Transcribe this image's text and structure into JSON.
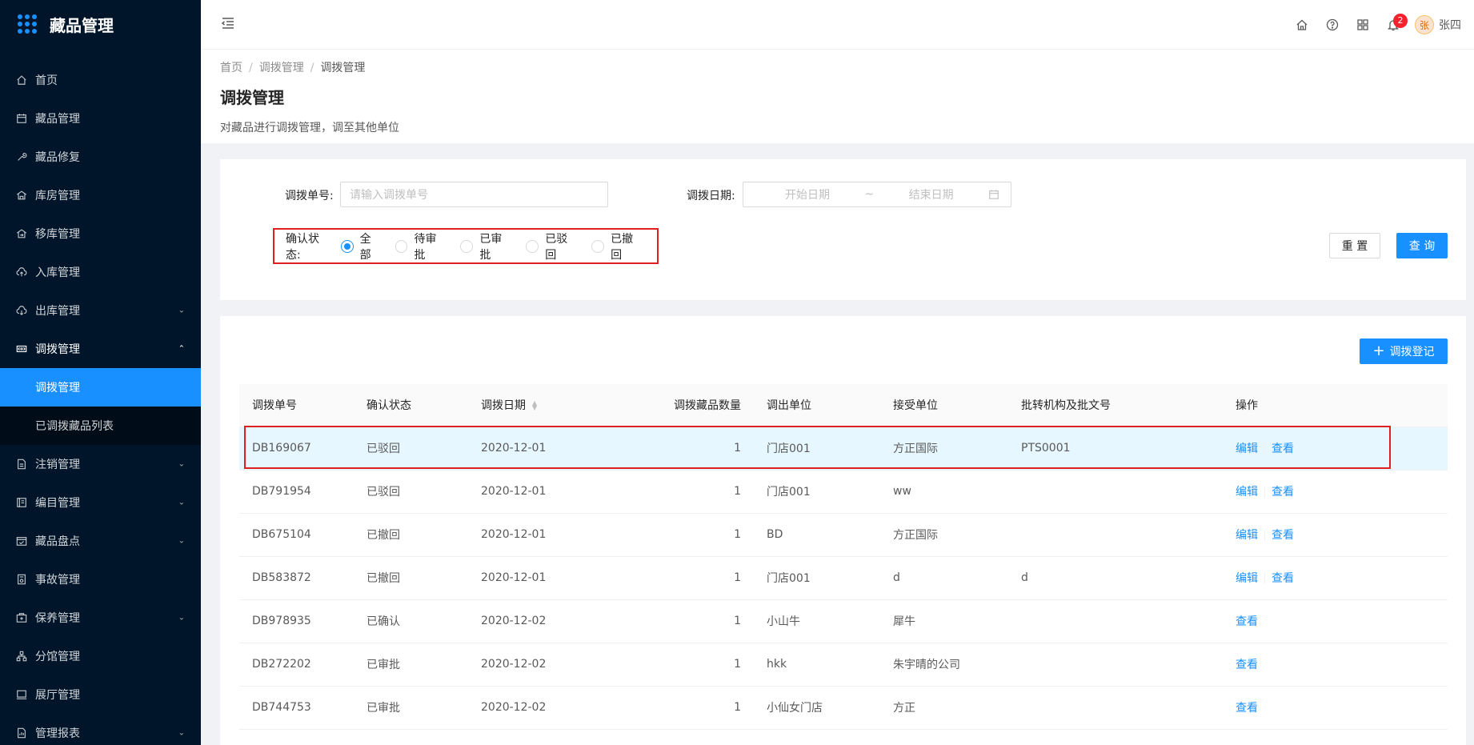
{
  "app": {
    "title": "藏品管理"
  },
  "sidebar": {
    "items": [
      {
        "label": "首页",
        "icon": "home-icon"
      },
      {
        "label": "藏品管理",
        "icon": "calendar-icon"
      },
      {
        "label": "藏品修复",
        "icon": "wrench-icon"
      },
      {
        "label": "库房管理",
        "icon": "warehouse-icon"
      },
      {
        "label": "移库管理",
        "icon": "move-icon"
      },
      {
        "label": "入库管理",
        "icon": "cloud-upload-icon"
      },
      {
        "label": "出库管理",
        "icon": "cloud-download-icon"
      },
      {
        "label": "调拨管理",
        "icon": "transfer-icon"
      },
      {
        "label": "注销管理",
        "icon": "file-icon"
      },
      {
        "label": "编目管理",
        "icon": "catalog-icon"
      },
      {
        "label": "藏品盘点",
        "icon": "check-icon"
      },
      {
        "label": "事故管理",
        "icon": "doc-icon"
      },
      {
        "label": "保养管理",
        "icon": "maintenance-icon"
      },
      {
        "label": "分馆管理",
        "icon": "branch-icon"
      },
      {
        "label": "展厅管理",
        "icon": "hall-icon"
      },
      {
        "label": "管理报表",
        "icon": "report-icon"
      }
    ],
    "submenu": [
      {
        "label": "调拨管理"
      },
      {
        "label": "已调拨藏品列表"
      }
    ]
  },
  "header": {
    "notification_count": "2",
    "avatar_char": "张",
    "username": "张四"
  },
  "breadcrumb": [
    "首页",
    "调拨管理",
    "调拨管理"
  ],
  "page": {
    "title": "调拨管理",
    "description": "对藏品进行调拨管理，调至其他单位"
  },
  "search": {
    "order_label": "调拨单号:",
    "order_placeholder": "请输入调拨单号",
    "date_label": "调拨日期:",
    "start_placeholder": "开始日期",
    "range_sep": "~",
    "end_placeholder": "结束日期",
    "status_label": "确认状态:",
    "status_options": [
      "全部",
      "待审批",
      "已审批",
      "已驳回",
      "已撤回"
    ],
    "selected_status": "全部",
    "reset_label": "重 置",
    "query_label": "查 询"
  },
  "table": {
    "add_label": "调拨登记",
    "columns": [
      "调拨单号",
      "确认状态",
      "调拨日期",
      "调拨藏品数量",
      "调出单位",
      "接受单位",
      "批转机构及批文号",
      "操作"
    ],
    "rows": [
      {
        "id": "DB169067",
        "status": "已驳回",
        "date": "2020-12-01",
        "qty": "1",
        "from": "门店001",
        "to": "方正国际",
        "approval": "PTS0001",
        "actions": [
          "编辑",
          "查看"
        ]
      },
      {
        "id": "DB791954",
        "status": "已驳回",
        "date": "2020-12-01",
        "qty": "1",
        "from": "门店001",
        "to": "ww",
        "approval": "",
        "actions": [
          "编辑",
          "查看"
        ]
      },
      {
        "id": "DB675104",
        "status": "已撤回",
        "date": "2020-12-01",
        "qty": "1",
        "from": "BD",
        "to": "方正国际",
        "approval": "",
        "actions": [
          "编辑",
          "查看"
        ]
      },
      {
        "id": "DB583872",
        "status": "已撤回",
        "date": "2020-12-01",
        "qty": "1",
        "from": "门店001",
        "to": "d",
        "approval": "d",
        "actions": [
          "编辑",
          "查看"
        ]
      },
      {
        "id": "DB978935",
        "status": "已确认",
        "date": "2020-12-02",
        "qty": "1",
        "from": "小山牛",
        "to": "犀牛",
        "approval": "",
        "actions": [
          "查看"
        ]
      },
      {
        "id": "DB272202",
        "status": "已审批",
        "date": "2020-12-02",
        "qty": "1",
        "from": "hkk",
        "to": "朱宇晴的公司",
        "approval": "",
        "actions": [
          "查看"
        ]
      },
      {
        "id": "DB744753",
        "status": "已审批",
        "date": "2020-12-02",
        "qty": "1",
        "from": "小仙女门店",
        "to": "方正",
        "approval": "",
        "actions": [
          "查看"
        ]
      }
    ]
  },
  "colors": {
    "sidebar_bg": "#001529",
    "primary": "#1890ff",
    "highlight_border": "#e02020",
    "selected_row": "#e6f7ff"
  }
}
